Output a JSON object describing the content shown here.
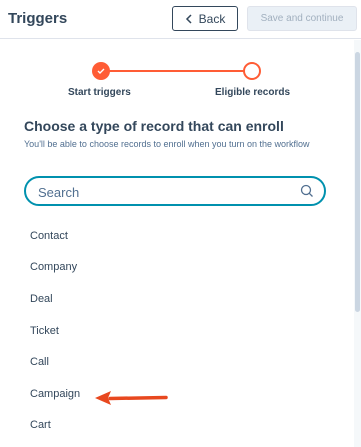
{
  "header": {
    "title": "Triggers",
    "back_label": "Back",
    "save_label": "Save and continue"
  },
  "stepper": {
    "steps": [
      {
        "label": "Start triggers",
        "status": "complete"
      },
      {
        "label": "Eligible records",
        "status": "incomplete"
      }
    ]
  },
  "main": {
    "heading": "Choose a type of record that can enroll",
    "subtext": "You'll be able to choose records to enroll when you turn on the workflow",
    "search": {
      "placeholder": "Search",
      "value": ""
    },
    "record_types": [
      "Contact",
      "Company",
      "Deal",
      "Ticket",
      "Call",
      "Campaign",
      "Cart"
    ]
  },
  "colors": {
    "accent": "#ff5c35",
    "focus": "#0091ae",
    "text": "#33475b"
  }
}
